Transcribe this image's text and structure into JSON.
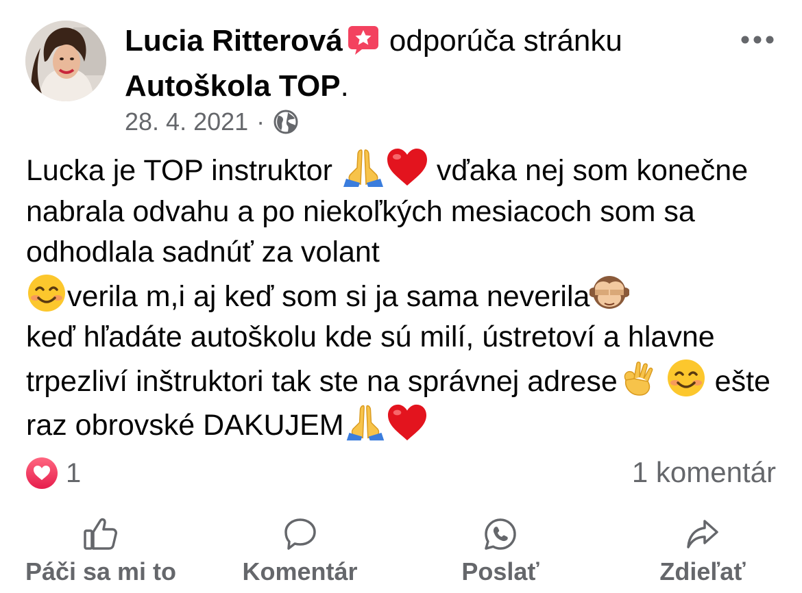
{
  "post": {
    "author": "Lucia Ritterová",
    "recommend_text": "odporúča stránku",
    "page_name": "Autoškola TOP",
    "page_name_suffix": ".",
    "date": "28. 4. 2021",
    "separator": "·",
    "audience_icon": "globe-icon",
    "text": {
      "s1": "Lucka je TOP instruktor ",
      "s2": " vďaka nej som konečne nabrala odvahu a po niekoľkých mesiacoch som sa odhodlala sadnúť za volant ",
      "s3": "verila m,i aj keď som si ja sama neverila",
      "s4": " keď hľadáte autoškolu kde sú milí, ústretoví  a hlavne trpezliví inštruktori tak ste na správnej adrese",
      "s5": " ",
      "s6": " ešte raz obrovské DAKUJEM"
    }
  },
  "stats": {
    "reaction_icon": "heart-icon",
    "reaction_count": "1",
    "comment_count": "1 komentár"
  },
  "actions": {
    "like": "Páči sa mi to",
    "comment": "Komentár",
    "send": "Poslať",
    "share": "Zdieľať"
  },
  "colors": {
    "text": "#050505",
    "secondary": "#65676b",
    "heart": "#f0284a",
    "recommend_badge": "#f3425f"
  }
}
